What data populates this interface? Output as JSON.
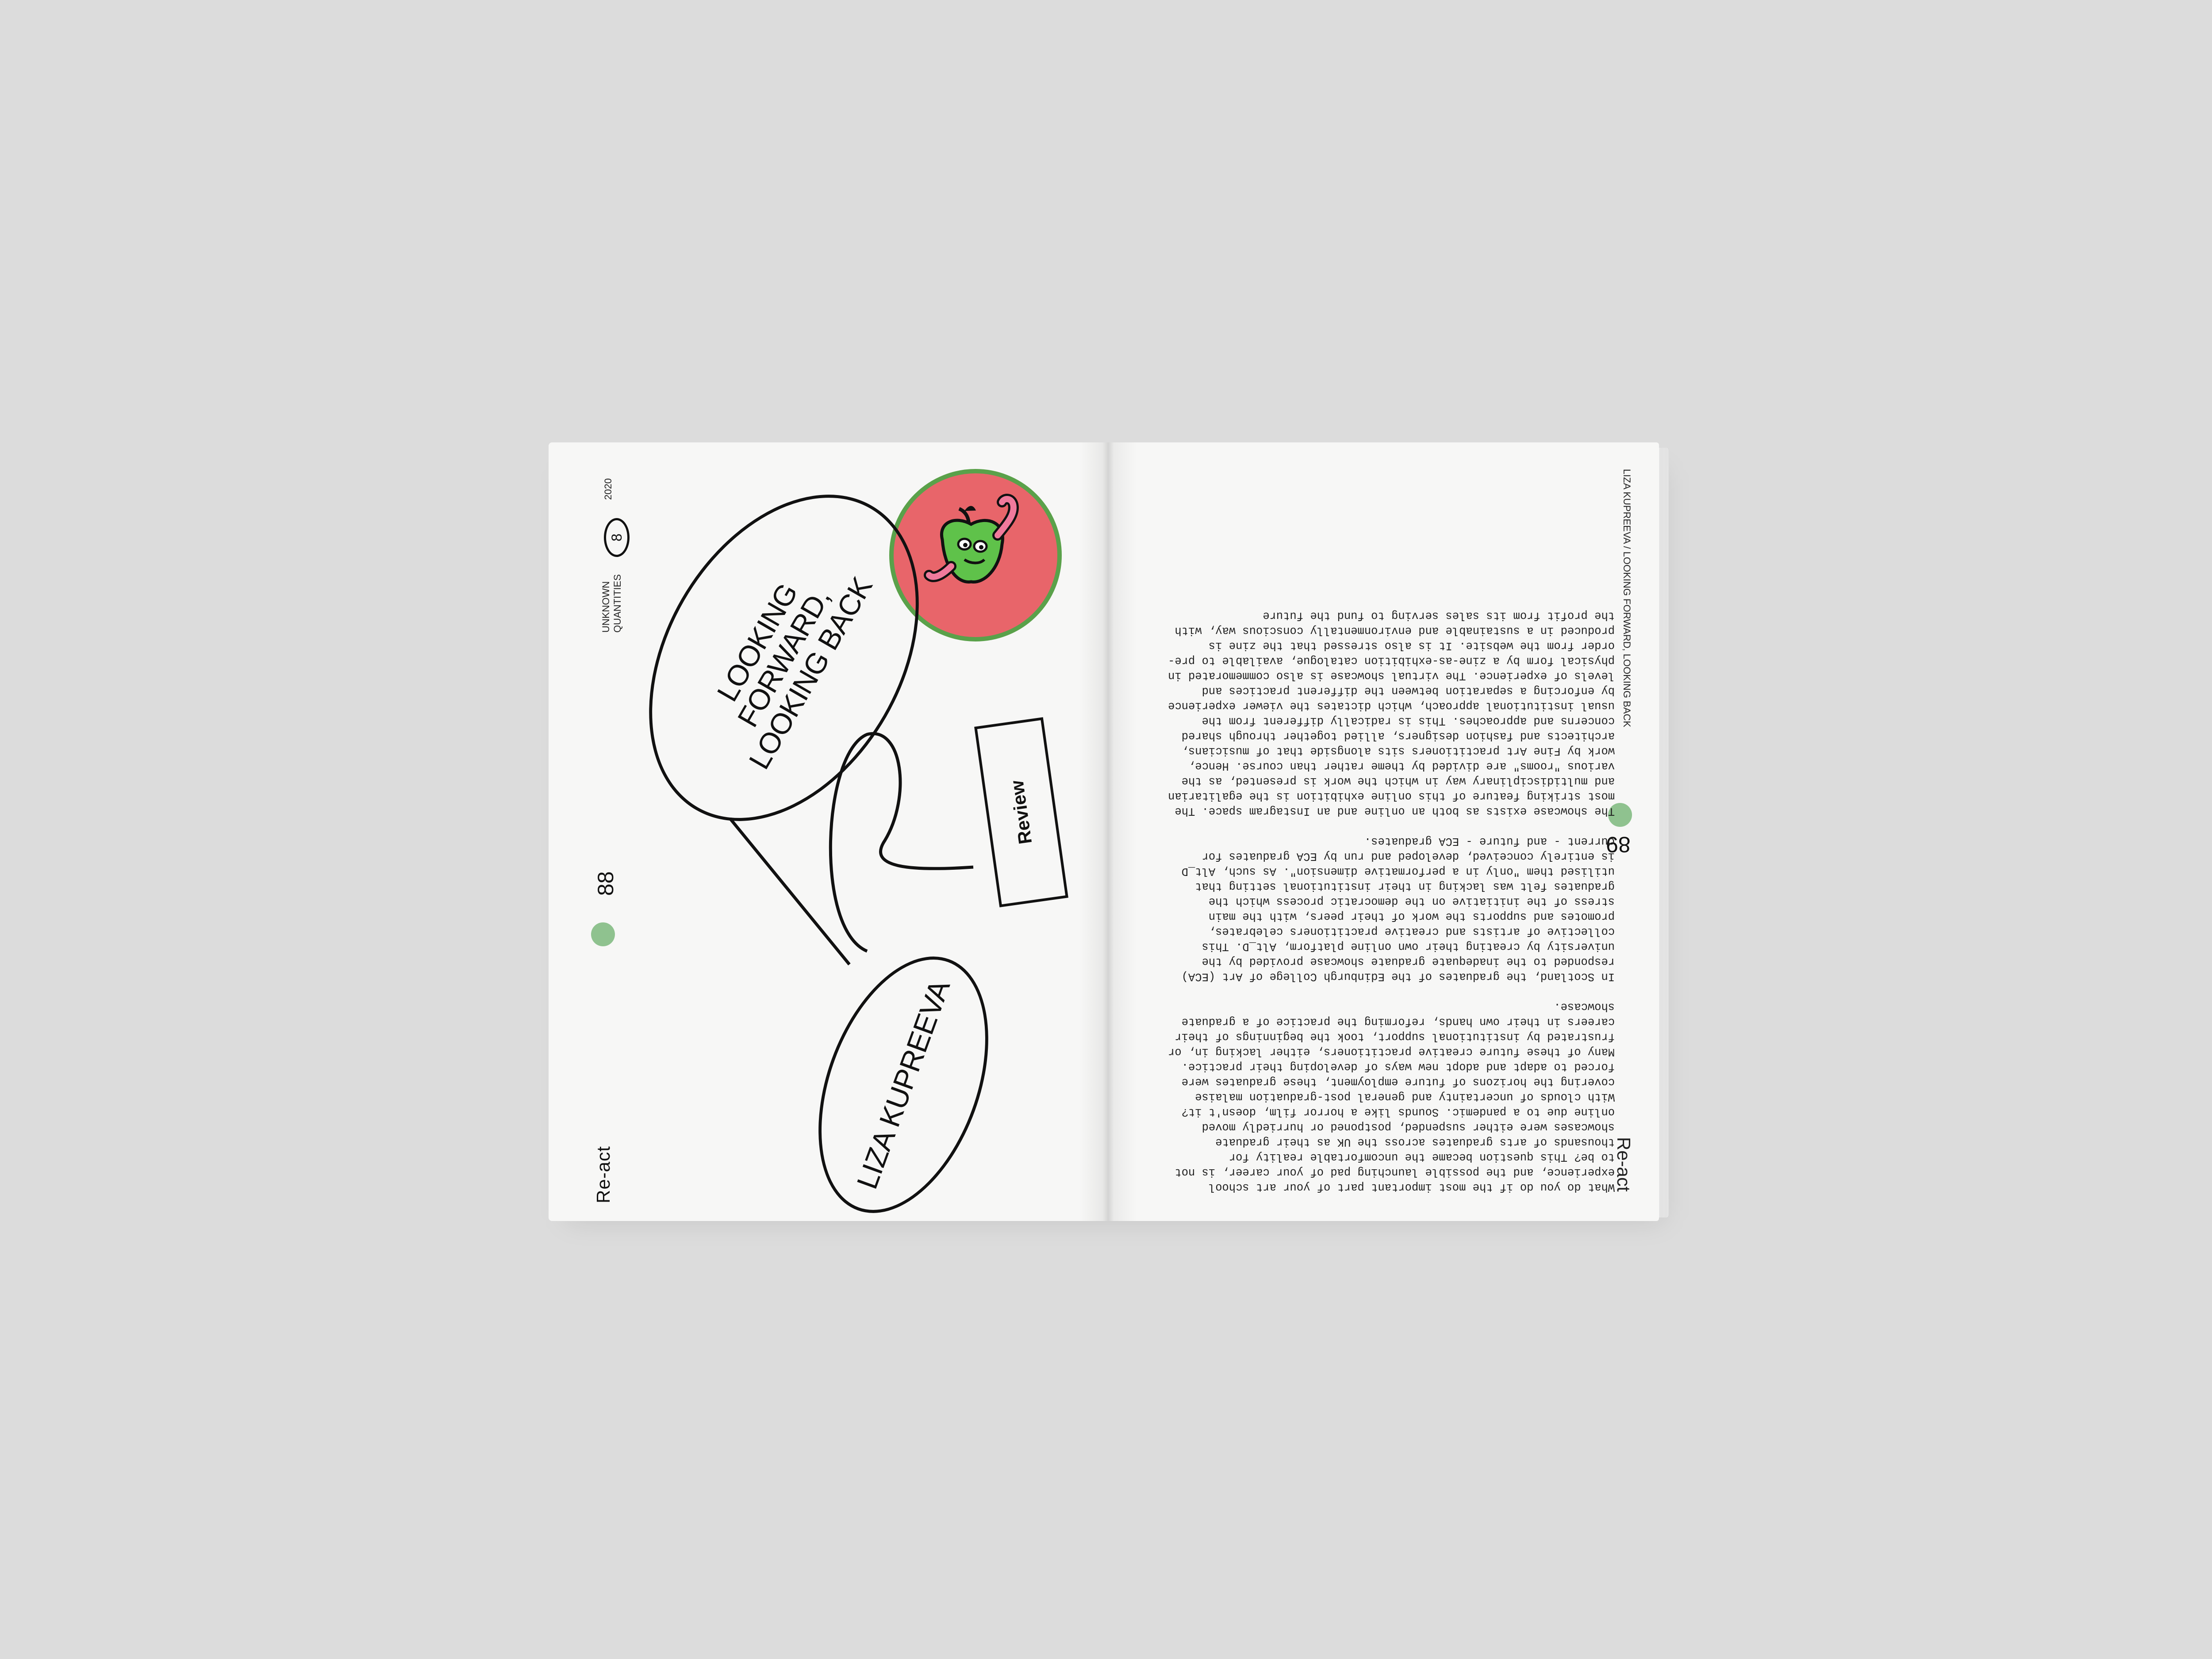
{
  "left_page": {
    "brand": "Re-act",
    "page_number": "88",
    "series_line1": "UNKNOWN",
    "series_line2": "QUANTITIES",
    "issue": "8",
    "year": "2020",
    "title_line1": "LOOKING FORWARD,",
    "title_line2": "LOOKING BACK",
    "author": "LIZA KUPREEVA",
    "section": "Review",
    "accent_red": "#e8656a",
    "accent_green": "#5aa14a",
    "dot_color": "#8fc28f"
  },
  "right_page": {
    "brand": "Re-act",
    "page_number": "89",
    "running_head": "LIZA KUPREEVA / LOOKING FORWARD, LOOKING BACK",
    "paragraphs": [
      "What do you do if the most important part of your art school experience, and the possible launching pad of your career, is not to be? This question became the uncomfortable reality for thousands of arts graduates across the UK as their graduate showcases were either suspended, postponed or hurriedly moved online due to a pandemic. Sounds like a horror film, doesn't it? With clouds of uncertainty and general post-graduation malaise covering the horizons of future employment, these graduates were forced to adapt and adopt new ways of developing their practice. Many of these future creative practitioners, either lacking in, or frustrated by institutional support, took the beginnings of their careers in their own hands, reforming the practice of a graduate showcase.",
      "In Scotland, the graduates of the Edinburgh College of Art (ECA) responded to the inadequate graduate showcase provided by the university by creating their own online platform, Alt_D. This collective of artists and creative practitioners celebrates, promotes and supports the work of their peers, with the main stress of the initiative on the democratic process which the graduates felt was lacking in their institutional setting that utilised them \"only in a performative dimension\". As such, Alt_D is entirely conceived, developed and run by ECA graduates for current - and future - ECA graduates.",
      "The showcase exists as both an online and an Instagram space. The most striking feature of this online exhibition is the egalitarian and multidisciplinary way in which the work is presented, as the various \"rooms\" are divided by theme rather than course. Hence, work by Fine Art practitioners sits alongside that of musicians, architects and fashion designers, allied together through shared concerns and approaches. This is radically different from the usual institutional approach, which dictates the viewer experience by enforcing a separation between the different practices and levels of experience. The virtual showcase is also commemorated in physical form by a zine-as-exhibition catalogue, available to pre-order from the website. It is also stressed that the zine is produced in a sustainable and environmentally conscious way, with the profit from its sales serving to fund the future"
    ]
  }
}
